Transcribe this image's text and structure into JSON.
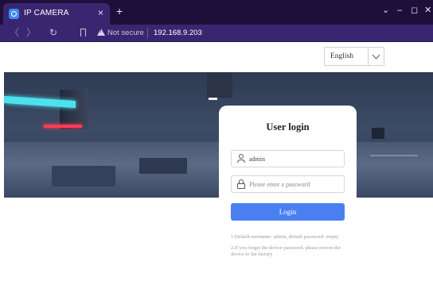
{
  "browser": {
    "tab_title": "IP CAMERA",
    "tab_close": "×",
    "new_tab": "+",
    "nav_back": "〈",
    "nav_forward": "〉",
    "nav_reload": "↻",
    "security_label": "Not secure",
    "url": "192.168.9.203",
    "window_controls": {
      "tab_search": "⌄",
      "minimize": "–",
      "maximize": "◻",
      "close": "✕"
    }
  },
  "language": {
    "selected": "English"
  },
  "login": {
    "title": "User login",
    "username_value": "admin",
    "password_placeholder": "Please enter a password",
    "submit_label": "Login",
    "hint_default": "1.Default username: admin, default password: empty",
    "hint_restore": "2.If you forget the device password, please restore the device to the factory"
  },
  "colors": {
    "accent": "#4a7ff0",
    "chrome_dark": "#1d0f3a",
    "chrome_tab": "#3a2670"
  }
}
